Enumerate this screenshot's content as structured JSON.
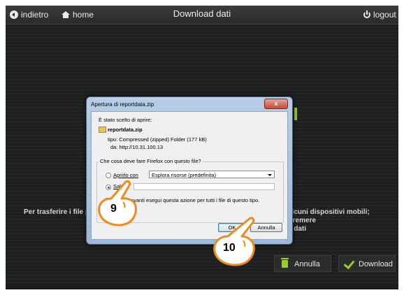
{
  "topbar": {
    "back_label": "indietro",
    "home_label": "home",
    "title": "Download dati",
    "logout_label": "logout"
  },
  "background": {
    "text_left": "Per trasferire i file pre",
    "text_right_line1": "alcuni dispositivi mobili; Premere",
    "text_right_line2": "e dati",
    "cancel_label": "Annulla",
    "download_label": "Download"
  },
  "dialog": {
    "title": "Apertura di reportdata.zip",
    "close_label": "x",
    "chosen_text": "È stato scelto di aprire:",
    "file_name": "reportdata.zip",
    "type_text": "tipo: Compressed (zipped) Folder (177 kB)",
    "from_text": "da: http://10.31.100.13",
    "group_title": "Che cosa deve fare Firefox con questo file?",
    "open_with_label": "Aprirlo con",
    "open_with_value": "Esplora risorse (predefinita)",
    "save_label": "Salva",
    "auto_text": "in avanti esegui questa azione per tutti i file di questo tipo.",
    "ok_label": "OK",
    "cancel_label": "Annulla"
  },
  "callouts": {
    "step_a": "9",
    "step_b": "10"
  },
  "colors": {
    "accent_green": "#9ccc2a",
    "dialog_frame": "#a9c2e0",
    "callout_orange": "#f08a1c"
  }
}
